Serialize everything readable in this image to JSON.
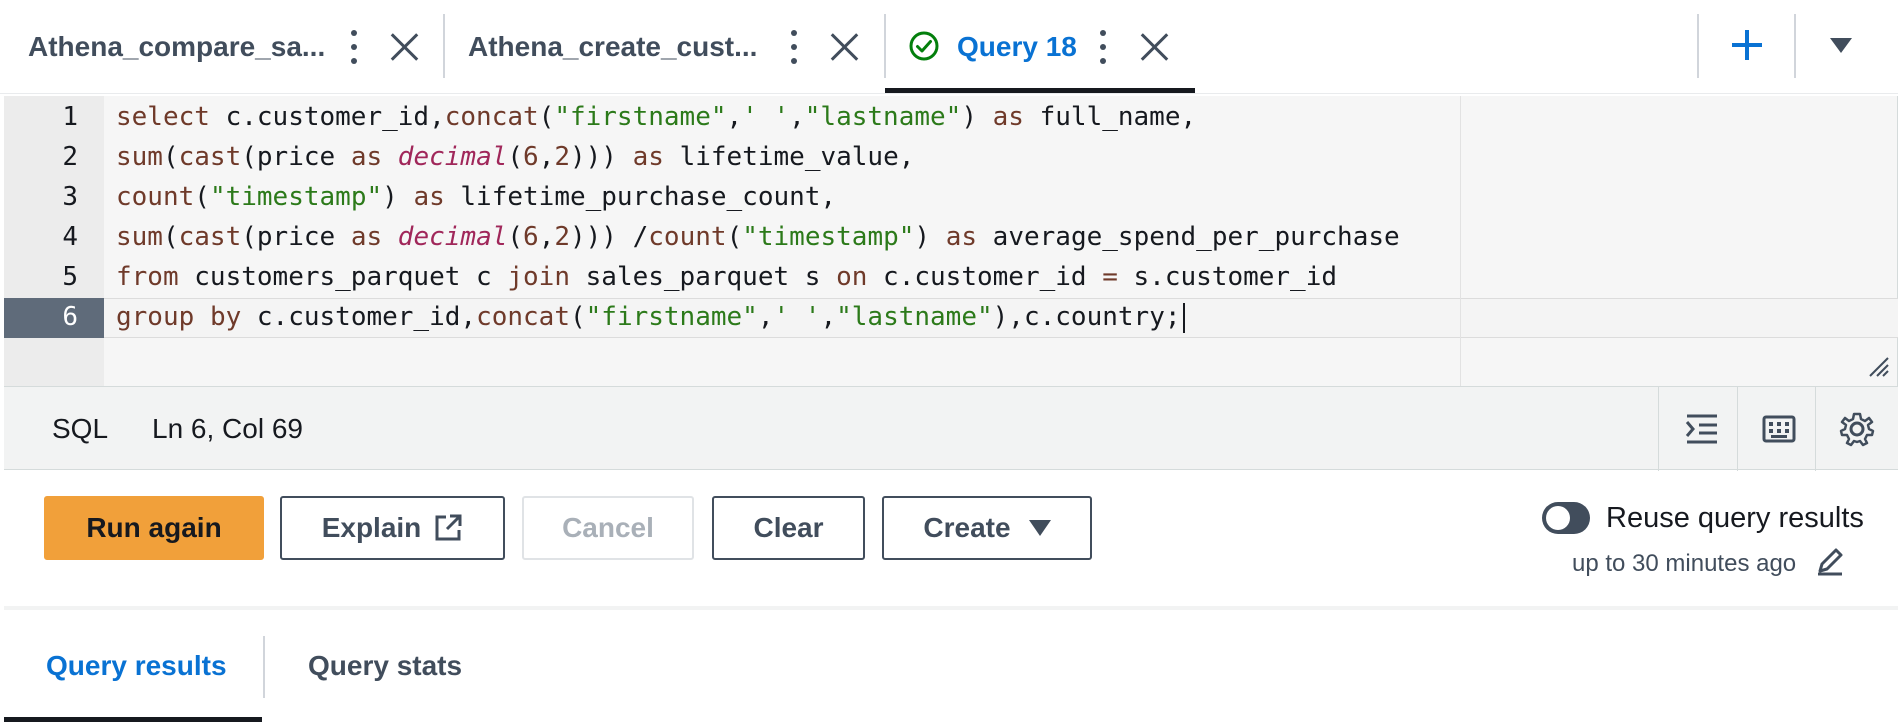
{
  "tabs": [
    {
      "label": "Athena_compare_sa...",
      "active": false
    },
    {
      "label": "Athena_create_cust...",
      "active": false
    },
    {
      "label": "Query 18",
      "active": true,
      "status": "check-circle-icon"
    }
  ],
  "editor": {
    "line_numbers": [
      "1",
      "2",
      "3",
      "4",
      "5",
      "6"
    ],
    "active_line": 6
  },
  "status_bar": {
    "language": "SQL",
    "cursor_position": "Ln 6, Col 69"
  },
  "actions": {
    "run_label": "Run again",
    "explain_label": "Explain",
    "cancel_label": "Cancel",
    "clear_label": "Clear",
    "create_label": "Create"
  },
  "reuse": {
    "label": "Reuse query results",
    "sub_label": "up to 30 minutes ago",
    "enabled": false
  },
  "result_tabs": [
    {
      "label": "Query results",
      "active": true
    },
    {
      "label": "Query stats",
      "active": false
    }
  ],
  "colors": {
    "accent_blue": "#0972d3",
    "primary_button": "#f1a03a",
    "success_green": "#037f0c"
  }
}
